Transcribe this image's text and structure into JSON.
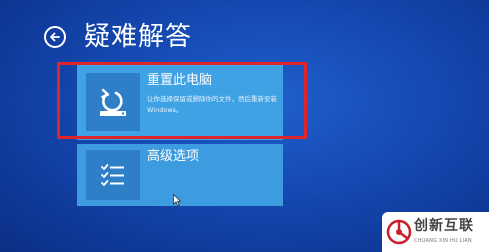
{
  "header": {
    "back_icon": "back-arrow-icon",
    "title": "疑难解答"
  },
  "options": [
    {
      "icon": "reset-pc-icon",
      "title": "重置此电脑",
      "description": "让你选择保留或删除你的文件，然后重新安装 Windows。"
    },
    {
      "icon": "advanced-options-checklist-icon",
      "title": "高级选项"
    }
  ],
  "colors": {
    "background": "#1548b0",
    "tile": "#3fa2e4",
    "highlight": "#e0242b"
  },
  "watermark": {
    "brand": "创新互联",
    "sub": "CHUANG XIN HU LIAN"
  }
}
